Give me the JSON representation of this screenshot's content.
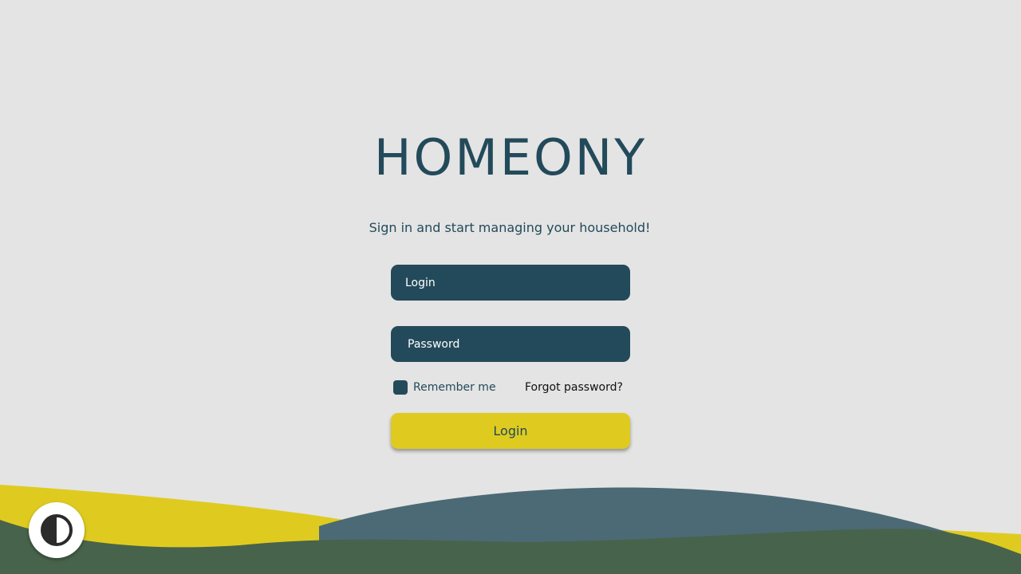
{
  "app": {
    "brand": "HOMEONY",
    "tagline": "Sign in and start managing your household!"
  },
  "form": {
    "login_placeholder": "Login",
    "login_value": "",
    "password_placeholder": "Password",
    "password_value": "",
    "remember_label": "Remember me",
    "remember_checked": false,
    "forgot_label": "Forgot password?",
    "submit_label": "Login"
  },
  "icons": {
    "theme_toggle": "contrast-icon"
  },
  "colors": {
    "background": "#e4e4e4",
    "primary": "#234a5a",
    "accent": "#dfcb20",
    "wave_blue": "#4b6a75",
    "wave_green": "#48634b"
  }
}
